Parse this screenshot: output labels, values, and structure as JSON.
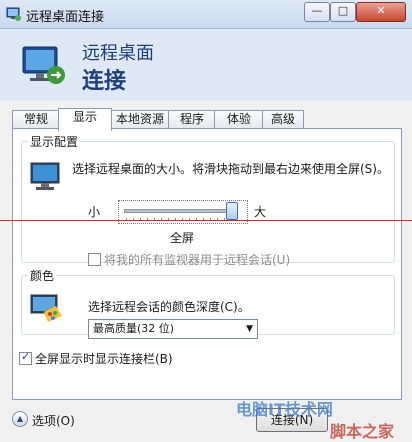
{
  "window": {
    "title": "远程桌面连接",
    "minimize_glyph": "—",
    "maximize_glyph": "□",
    "close_glyph": "✕"
  },
  "header": {
    "line1": "远程桌面",
    "line2": "连接"
  },
  "tabs": [
    {
      "label": "常规"
    },
    {
      "label": "显示"
    },
    {
      "label": "本地资源"
    },
    {
      "label": "程序"
    },
    {
      "label": "体验"
    },
    {
      "label": "高级"
    }
  ],
  "active_tab": "显示",
  "display_config": {
    "legend": "显示配置",
    "description": "选择远程桌面的大小。将滑块拖动到最右边来使用全屏(S)。",
    "small_label": "小",
    "large_label": "大",
    "slider_value_label": "全屏",
    "slider_position": 1.0,
    "multi_monitor": {
      "label": "将我的所有监视器用于远程会话(U)",
      "checked": false,
      "enabled": false
    }
  },
  "colors": {
    "legend": "颜色",
    "description": "选择远程会话的颜色深度(C)。",
    "selected": "最高质量(32 位)"
  },
  "connection_bar": {
    "label": "全屏显示时显示连接栏(B)",
    "checked": true
  },
  "footer": {
    "options_label": "选项(O)",
    "options_glyph": "▲",
    "connect_label": "连接(N)"
  },
  "watermark": {
    "text1": "电脑IT技术网",
    "text2": "脚本之家"
  }
}
